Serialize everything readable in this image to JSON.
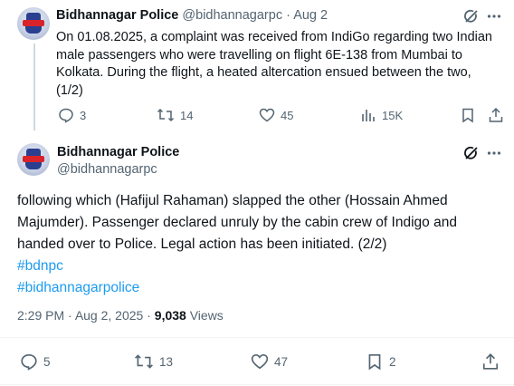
{
  "tweet1": {
    "name": "Bidhannagar Police",
    "handle": "@bidhannagarpc",
    "separator": "·",
    "date": "Aug 2",
    "text": "On 01.08.2025, a complaint was received from IndiGo regarding two Indian male passengers who were travelling on flight 6E-138 from Mumbai to Kolkata. During the flight, a heated altercation ensued between the two, (1/2)",
    "replies": "3",
    "reposts": "14",
    "likes": "45",
    "views": "15K"
  },
  "tweet2": {
    "name": "Bidhannagar Police",
    "handle": "@bidhannagarpc",
    "text": "following which  (Hafijul Rahaman) slapped the other (Hossain Ahmed Majumder). Passenger declared unruly by the cabin crew of Indigo and handed over to Police. Legal action has been initiated. (2/2)",
    "hashtags": [
      "#bdnpc",
      "#bidhannagarpolice"
    ],
    "time": "2:29 PM",
    "date": "Aug 2, 2025",
    "views_count": "9,038",
    "views_label": "Views",
    "replies": "5",
    "reposts": "13",
    "likes": "47",
    "bookmarks": "2"
  },
  "icons": {
    "grok": "grok-icon",
    "more": "more-icon",
    "reply": "reply-icon",
    "repost": "repost-icon",
    "like": "like-icon",
    "views": "views-icon",
    "bookmark": "bookmark-icon",
    "share": "share-icon"
  },
  "colors": {
    "link": "#1d9bf0",
    "muted": "#536471",
    "text": "#0f1419"
  }
}
